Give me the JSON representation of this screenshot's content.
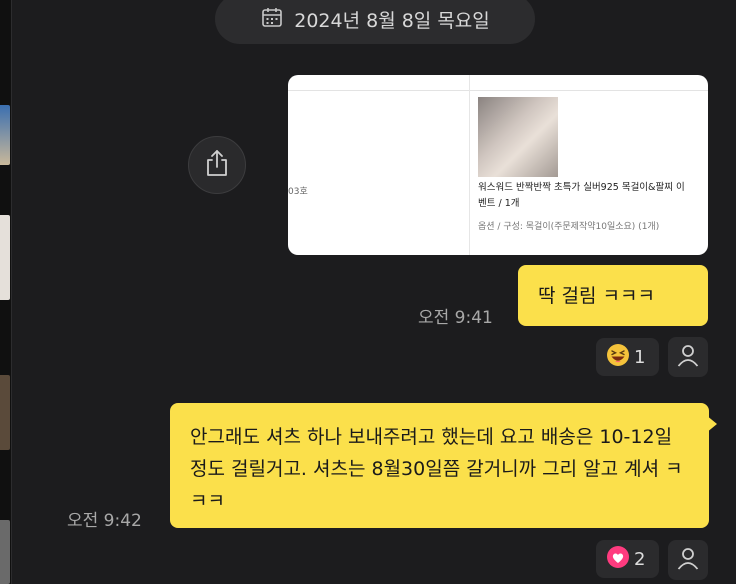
{
  "date_header": {
    "text": "2024년 8월 8일 목요일",
    "icon": "calendar-icon"
  },
  "shared_image": {
    "left_text": "03호",
    "product_name": "워스워드 반짝반짝 초특가 실버925 목걸이&팔찌 이벤트 / 1개",
    "product_option": "옵션 / 구성: 목걸이(주문제작약10일소요) (1개)"
  },
  "messages": [
    {
      "text": "딱 걸림 ㅋㅋㅋ",
      "time": "오전 9:41",
      "reaction": {
        "icon": "grinning-squint-emoji",
        "count": "1"
      }
    },
    {
      "text": "안그래도 셔츠 하나 보내주려고 했는데 요고 배송은 10-12일정도 걸릴거고. 셔츠는 8월30일쯤 갈거니까 그리 알고 계셔 ㅋㅋㅋ",
      "time": "오전 9:42",
      "reaction": {
        "icon": "heart-emoji",
        "count": "2"
      }
    }
  ],
  "colors": {
    "background": "#1c1c1e",
    "bubble": "#fbe04b",
    "heart": "#ff3b7f"
  }
}
